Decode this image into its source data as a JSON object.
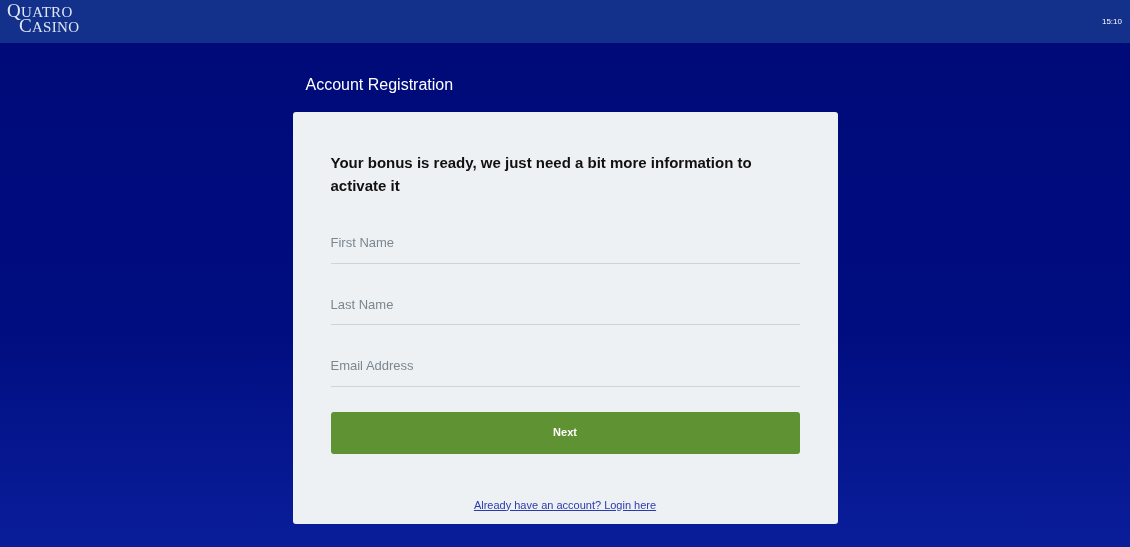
{
  "header": {
    "logo": [
      "QUATRO",
      "CASINO"
    ],
    "time": "15:10"
  },
  "page_title": "Account Registration",
  "form": {
    "heading": "Your bonus is ready, we just need a bit more information to activate it",
    "fields": [
      {
        "placeholder": "First Name"
      },
      {
        "placeholder": "Last Name"
      },
      {
        "placeholder": "Email Address"
      }
    ],
    "submit": "Next",
    "login_link": "Already have an account? Login here"
  }
}
